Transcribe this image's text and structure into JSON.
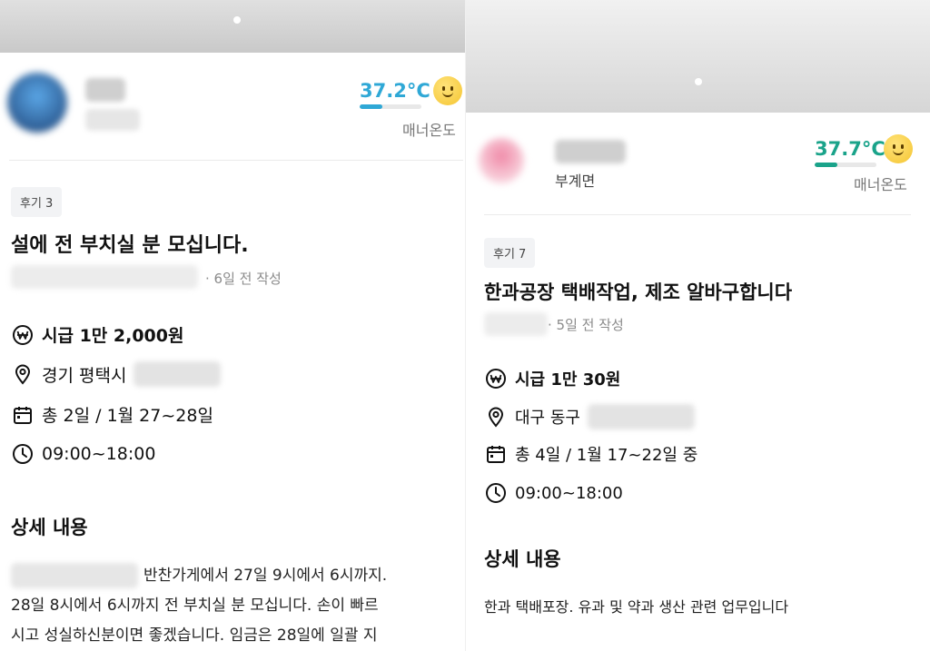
{
  "left": {
    "manner_temp": "37.2°C",
    "manner_temp_fraction": 0.37,
    "manner_label": "매너온도",
    "accent": "#2fa8d6",
    "review_chip": "후기 3",
    "title": "설에 전 부치실 분 모십니다.",
    "written": "· 6일 전 작성",
    "wage": "시급 1만 2,000원",
    "location": "경기 평택시",
    "schedule": "총 2일 / 1월 27~28일",
    "hours": "09:00~18:00",
    "section_title": "상세 내용",
    "body_line1": "반찬가게에서 27일 9시에서 6시까지.",
    "body_line2": "28일 8시에서 6시까지 전 부치실 분 모십니다. 손이 빠르",
    "body_line3": "시고 성실하신분이면 좋겠습니다. 임금은 28일에 일괄 지"
  },
  "right": {
    "user_region": "부계면",
    "manner_temp": "37.7°C",
    "manner_temp_fraction": 0.37,
    "manner_label": "매너온도",
    "accent": "#1aa38a",
    "review_chip": "후기 7",
    "title": "한과공장 택배작업, 제조 알바구합니다",
    "written": "· 5일 전 작성",
    "wage": "시급 1만 30원",
    "location": "대구 동구",
    "schedule": "총 4일 / 1월 17~22일 중",
    "hours": "09:00~18:00",
    "section_title": "상세 내용",
    "body_line1": "한과 택배포장. 유과 및 약과 생산 관련 업무입니다"
  }
}
